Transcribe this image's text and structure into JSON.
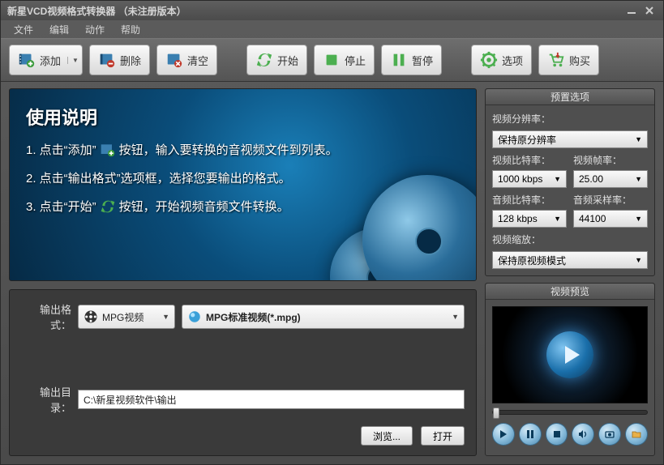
{
  "title": "新星VCD视频格式转换器 （未注册版本）",
  "menu": {
    "file": "文件",
    "edit": "编辑",
    "action": "动作",
    "help": "帮助"
  },
  "toolbar": {
    "add": "添加",
    "delete": "删除",
    "clear": "清空",
    "start": "开始",
    "stop": "停止",
    "pause": "暂停",
    "options": "选项",
    "buy": "购买"
  },
  "banner": {
    "heading": "使用说明",
    "step1a": "1. 点击“添加”",
    "step1b": "按钮，输入要转换的音视频文件到列表。",
    "step2": "2. 点击“输出格式”选项框，选择您要输出的格式。",
    "step3a": "3. 点击“开始”",
    "step3b": "按钮，开始视频音频文件转换。"
  },
  "output": {
    "format_label": "输出格式：",
    "format_value": "MPG视频",
    "profile_value": "MPG标准视频(*.mpg)",
    "dir_label": "输出目录：",
    "dir_value": "C:\\新星视频软件\\输出",
    "browse": "浏览...",
    "open": "打开"
  },
  "presets": {
    "panel_title": "预置选项",
    "res_label": "视频分辨率：",
    "res_value": "保持原分辨率",
    "vbitrate_label": "视频比特率：",
    "vbitrate_value": "1000 kbps",
    "fps_label": "视频帧率：",
    "fps_value": "25.00",
    "abitrate_label": "音频比特率：",
    "abitrate_value": "128 kbps",
    "asample_label": "音频采样率：",
    "asample_value": "44100",
    "scale_label": "视频缩放：",
    "scale_value": "保持原视频模式"
  },
  "preview": {
    "panel_title": "视频预览"
  }
}
